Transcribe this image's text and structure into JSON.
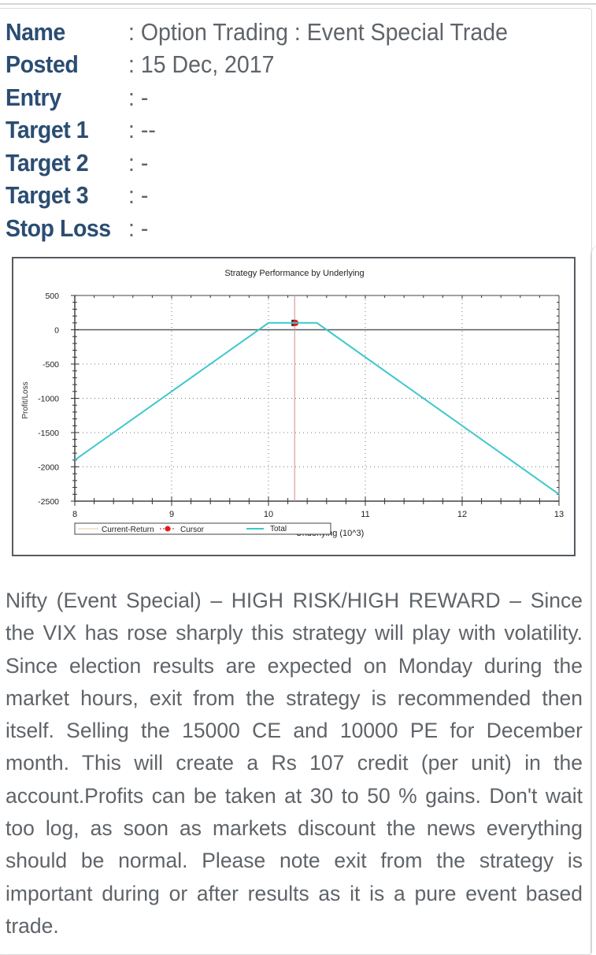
{
  "meta": {
    "rows": [
      {
        "label": "Name",
        "value": ": Option Trading : Event Special Trade"
      },
      {
        "label": "Posted",
        "value": ": 15 Dec, 2017"
      },
      {
        "label": "Entry",
        "value": ": -"
      },
      {
        "label": "Target 1",
        "value": ": --"
      },
      {
        "label": "Target 2",
        "value": ": -"
      },
      {
        "label": "Target 3",
        "value": ": -"
      },
      {
        "label": "Stop Loss",
        "value": ": -"
      }
    ]
  },
  "colors": {
    "label": "#2b4d72",
    "text": "#5f6469",
    "total_line": "#3cc8cc",
    "cursor": "#e21a1a",
    "cursor_line": "#d98a8a",
    "current_return": "#e8c9a0",
    "zero_line": "#555b60"
  },
  "chart_data": {
    "type": "line",
    "title": "Strategy Performance by Underlying",
    "xlabel": "Underlying (10^3)",
    "ylabel": "Profit/Loss",
    "xlim": [
      8,
      13
    ],
    "ylim": [
      -2500,
      500
    ],
    "x_ticks": [
      8,
      9,
      10,
      11,
      12,
      13
    ],
    "y_ticks": [
      500,
      0,
      -500,
      -1000,
      -1500,
      -2000,
      -2500
    ],
    "grid": true,
    "legend_position": "bottom",
    "series": [
      {
        "name": "Current-Return",
        "x": [],
        "y": []
      },
      {
        "name": "Cursor",
        "x": [
          10.27
        ],
        "y": [
          100
        ]
      },
      {
        "name": "Total",
        "x": [
          8,
          10,
          10.5,
          13
        ],
        "y": [
          -1900,
          100,
          100,
          -2400
        ]
      }
    ],
    "cursor_x": 10.27
  },
  "body_text": "Nifty (Event Special) – HIGH RISK/HIGH REWARD – Since the VIX has rose sharply this strategy will play with volatility. Since election results are expected on Monday during the market hours, exit from the strategy is recommended then itself. Selling the 15000 CE and 10000 PE for December month. This will create a Rs 107 credit (per unit) in the account.Profits can be taken at 30 to 50 % gains. Don't wait too log, as soon as markets discount the news everything should be normal. Please note exit from the strategy is important during or after results as it is a pure event based trade."
}
